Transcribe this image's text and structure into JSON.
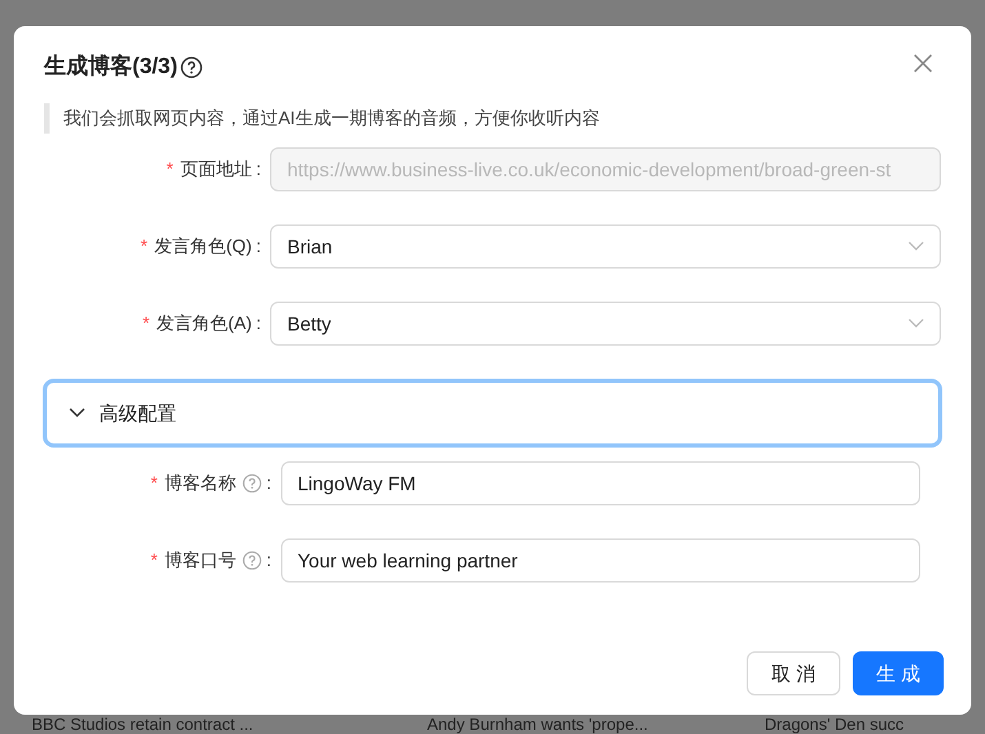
{
  "background": {
    "headlines": [
      "BBC Studios retain contract ...",
      "Andy Burnham wants 'prope...",
      "Dragons' Den succ"
    ]
  },
  "dialog": {
    "title": "生成博客(3/3)",
    "description": "我们会抓取网页内容，通过AI生成一期博客的音频，方便你收听内容",
    "fields": [
      {
        "kind": "input",
        "required_mark": "*",
        "label": "页面地址",
        "colon": ":",
        "disabled": true,
        "value": "https://www.business-live.co.uk/economic-development/broad-green-st"
      },
      {
        "kind": "select",
        "required_mark": "*",
        "label": "发言角色(Q)",
        "colon": ":",
        "disabled": false,
        "value": "Brian"
      },
      {
        "kind": "select",
        "required_mark": "*",
        "label": "发言角色(A)",
        "colon": ":",
        "disabled": false,
        "value": "Betty"
      }
    ],
    "advanced": {
      "label": "高级配置",
      "expanded": true,
      "fields": [
        {
          "required_mark": "*",
          "label": "博客名称",
          "help": true,
          "colon": ":",
          "value": "LingoWay FM"
        },
        {
          "required_mark": "*",
          "label": "博客口号",
          "help": true,
          "colon": ":",
          "value": "Your web learning partner"
        }
      ]
    },
    "buttons": [
      {
        "label": "取 消",
        "kind": "default"
      },
      {
        "label": "生 成",
        "kind": "primary"
      }
    ]
  }
}
